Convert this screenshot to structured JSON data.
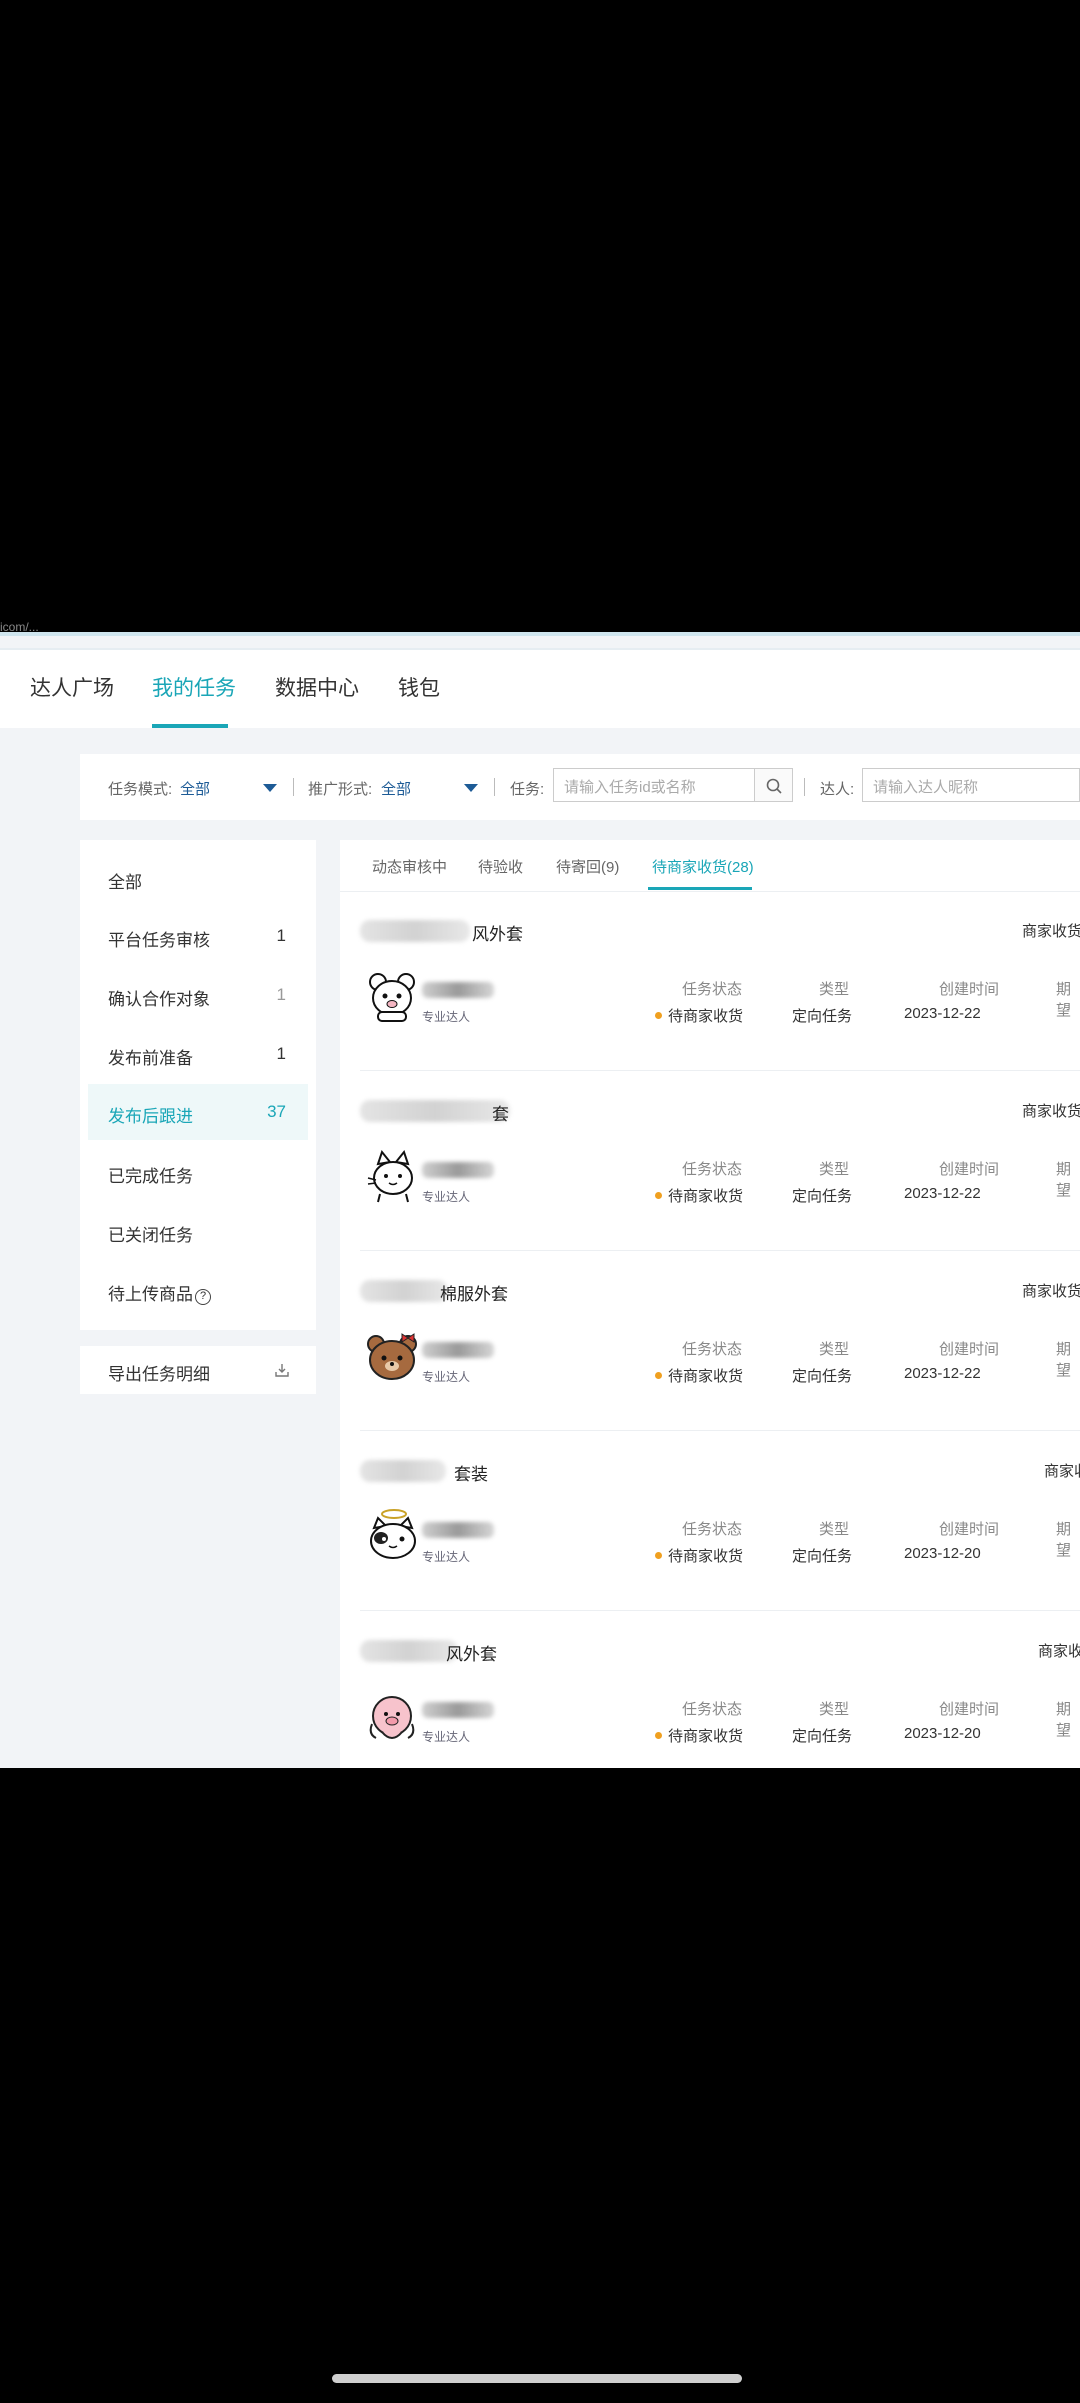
{
  "window": {
    "corner_text": "icom/..."
  },
  "nav": {
    "items": [
      {
        "label": "达人广场"
      },
      {
        "label": "我的任务"
      },
      {
        "label": "数据中心"
      },
      {
        "label": "钱包"
      }
    ],
    "active": "我的任务"
  },
  "filters": {
    "mode_label": "任务模式:",
    "mode_value": "全部",
    "promo_label": "推广形式:",
    "promo_value": "全部",
    "task_label": "任务:",
    "task_placeholder": "请输入任务id或名称",
    "talent_label": "达人:",
    "talent_placeholder": "请输入达人昵称"
  },
  "sidebar": {
    "items": [
      {
        "label": "全部",
        "count": ""
      },
      {
        "label": "平台任务审核",
        "count": "1"
      },
      {
        "label": "确认合作对象",
        "count": "1"
      },
      {
        "label": "发布前准备",
        "count": "1"
      },
      {
        "label": "发布后跟进",
        "count": "37"
      },
      {
        "label": "已完成任务",
        "count": ""
      },
      {
        "label": "已关闭任务",
        "count": ""
      },
      {
        "label": "待上传商品",
        "count": ""
      }
    ],
    "active_index": 4,
    "help_glyph": "?",
    "export_label": "导出任务明细"
  },
  "tabs": {
    "items": [
      {
        "label": "动态审核中"
      },
      {
        "label": "待验收"
      },
      {
        "label": "待寄回(9)"
      },
      {
        "label": "待商家收货(28)"
      }
    ],
    "active_index": 3
  },
  "columns": {
    "status": "任务状态",
    "type": "类型",
    "created": "创建时间",
    "period": "期望"
  },
  "cards": [
    {
      "title": "风外套",
      "right_status": "商家收货",
      "role": "专业达人",
      "status": "待商家收货",
      "type": "定向任务",
      "created": "2023-12-22",
      "avatar": "white-bear-icon"
    },
    {
      "title": "套",
      "right_status": "商家收货",
      "role": "专业达人",
      "status": "待商家收货",
      "type": "定向任务",
      "created": "2023-12-22",
      "avatar": "white-cat-icon"
    },
    {
      "title": "棉服外套",
      "right_status": "商家收货",
      "role": "专业达人",
      "status": "待商家收货",
      "type": "定向任务",
      "created": "2023-12-22",
      "avatar": "brown-bear-icon"
    },
    {
      "title": "套装",
      "right_status": "商家收",
      "role": "专业达人",
      "status": "待商家收货",
      "type": "定向任务",
      "created": "2023-12-20",
      "avatar": "angel-cat-icon"
    },
    {
      "title": "风外套",
      "right_status": "商家收",
      "role": "专业达人",
      "status": "待商家收货",
      "type": "定向任务",
      "created": "2023-12-20",
      "avatar": "pink-pig-icon"
    }
  ],
  "colors": {
    "accent": "#1aa6b7",
    "status_dot": "#f0a020",
    "filter_value": "#1d5b96"
  }
}
